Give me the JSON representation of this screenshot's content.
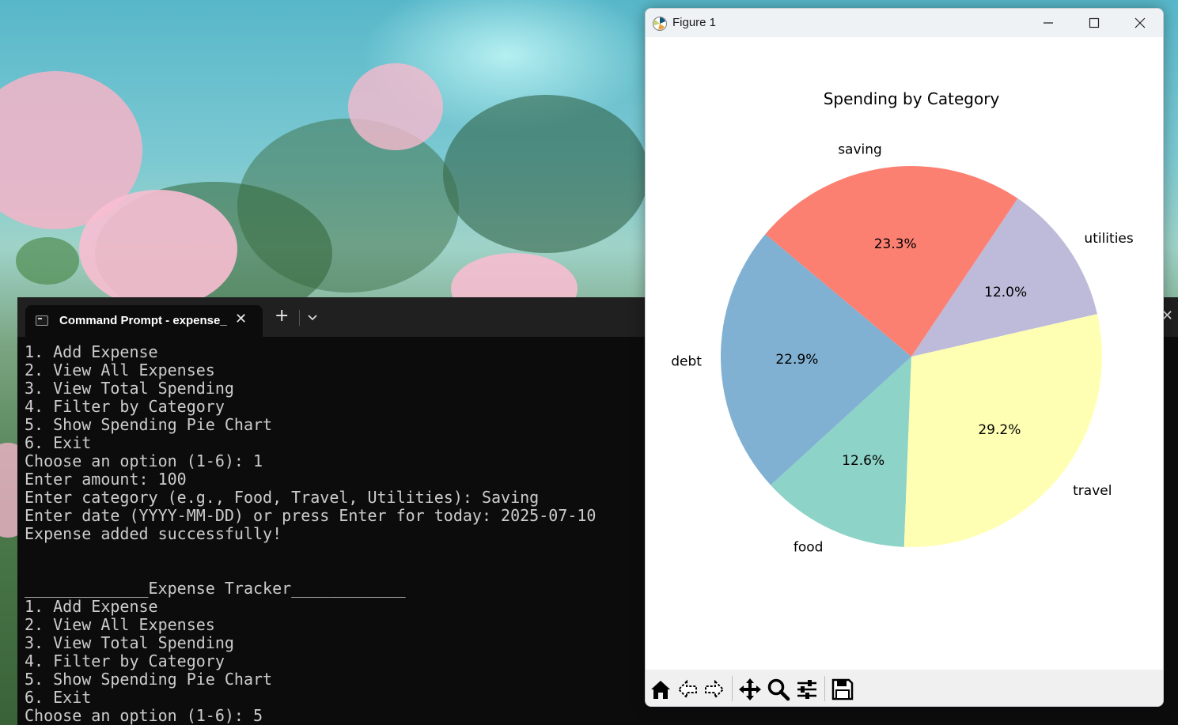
{
  "terminal": {
    "tab_title": "Command Prompt - expense_",
    "output_lines": [
      "1. Add Expense",
      "2. View All Expenses",
      "3. View Total Spending",
      "4. Filter by Category",
      "5. Show Spending Pie Chart",
      "6. Exit",
      "Choose an option (1-6): 1",
      "Enter amount: 100",
      "Enter category (e.g., Food, Travel, Utilities): Saving",
      "Enter date (YYYY-MM-DD) or press Enter for today: 2025-07-10",
      "Expense added successfully!",
      "",
      "",
      "_____________Expense Tracker____________",
      "1. Add Expense",
      "2. View All Expenses",
      "3. View Total Spending",
      "4. Filter by Category",
      "5. Show Spending Pie Chart",
      "6. Exit",
      "Choose an option (1-6): 5"
    ]
  },
  "figure_window": {
    "title": "Figure 1",
    "toolbar_icons": [
      "home-icon",
      "back-icon",
      "forward-icon",
      "pan-icon",
      "zoom-icon",
      "configure-subplots-icon",
      "save-icon"
    ]
  },
  "chart_data": {
    "type": "pie",
    "title": "Spending by Category",
    "start_angle": 140,
    "direction": "counterclockwise",
    "slices": [
      {
        "label": "debt",
        "value": 22.9,
        "pct_label": "22.9%",
        "color": "#80b1d3"
      },
      {
        "label": "food",
        "value": 12.6,
        "pct_label": "12.6%",
        "color": "#8dd3c7"
      },
      {
        "label": "travel",
        "value": 29.2,
        "pct_label": "29.2%",
        "color": "#ffffb3"
      },
      {
        "label": "utilities",
        "value": 12.0,
        "pct_label": "12.0%",
        "color": "#bebada"
      },
      {
        "label": "saving",
        "value": 23.3,
        "pct_label": "23.3%",
        "color": "#fb8072"
      }
    ]
  }
}
